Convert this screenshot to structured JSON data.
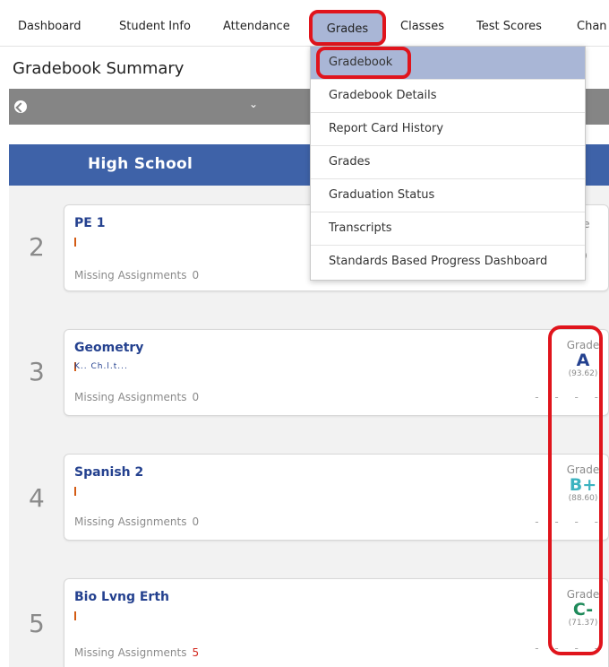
{
  "nav": {
    "items": [
      "Dashboard",
      "Student Info",
      "Attendance",
      "Grades",
      "Classes",
      "Test Scores",
      "Chan"
    ],
    "active": "Grades"
  },
  "page_title": "Gradebook Summary",
  "school": "High School",
  "dropdown": {
    "items": [
      "Gradebook",
      "Gradebook Details",
      "Report Card History",
      "Grades",
      "Graduation Status",
      "Transcripts",
      "Standards Based Progress Dashboard"
    ]
  },
  "missing_label": "Missing Assignments",
  "grade_label": "Grade",
  "courses": [
    {
      "period": "2",
      "name": "PE 1",
      "missing": "0",
      "grade_fragment": "de",
      "pct_fragment": "6)"
    },
    {
      "period": "3",
      "name": "Geometry",
      "missing": "0",
      "grade": "A",
      "pct": "(93.62)",
      "grade_color": "#24418f",
      "teacher_obscured": "K.. Ch.l.t..."
    },
    {
      "period": "4",
      "name": "Spanish 2",
      "missing": "0",
      "grade": "B+",
      "pct": "(88.60)",
      "grade_color": "#3cb3c0"
    },
    {
      "period": "5",
      "name": "Bio Lvng Erth",
      "missing": "5",
      "grade": "C-",
      "pct": "(71.37)",
      "grade_color": "#1e8a5a"
    }
  ],
  "dashes": "- - - -"
}
